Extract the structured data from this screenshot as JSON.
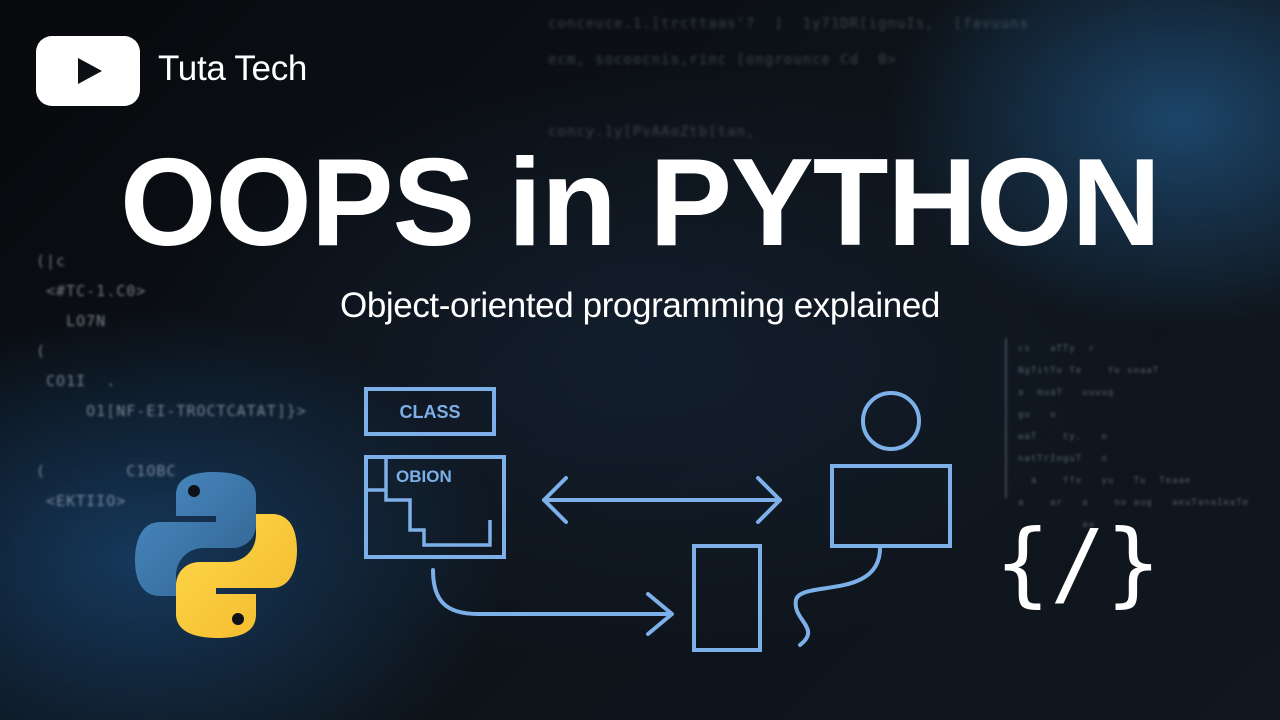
{
  "channel": {
    "name": "Tuta Tech",
    "logo_icon": "youtube-play-icon"
  },
  "headline": "OOPS in PYTHON",
  "subtitle": "Object-oriented programming explained",
  "diagram": {
    "class_label": "CLASS",
    "object_label": "OBION",
    "stroke_color": "#7db0e8",
    "icons": [
      "python-logo-icon",
      "person-icon",
      "code-brackets-icon"
    ]
  },
  "background_code": {
    "top": "conceuce.1.[trcttaas'?  ]  1y71DR[ignuIs,  [favuuns\necm, socoocnis,rinc [ongrounce Cd  0>\n\nconcy.1y[PvAAoZtb[tan,",
    "left": "(|c\n <#TC-1.C0>\n   LO7N\n(\n CO1I  .\n     O1[NF-EI-TROCTCATAT]}>\n\n(        C1OBC\n <EKTIIO>",
    "right": "cs   aTTy  r\nNgTitTo Te    Yo soaaT\na  muaT   uuuug\ngu   o\nwaT    ty.   o\nnatTrIoguT   o\n  a    ffo   yu   Tu  Teaae\na    ar   a    no aug   aeuTanaIeaTe\n          au"
  },
  "colors": {
    "accent": "#7db0e8",
    "python_blue": "#3b74a8",
    "python_yellow": "#f5c93d"
  }
}
